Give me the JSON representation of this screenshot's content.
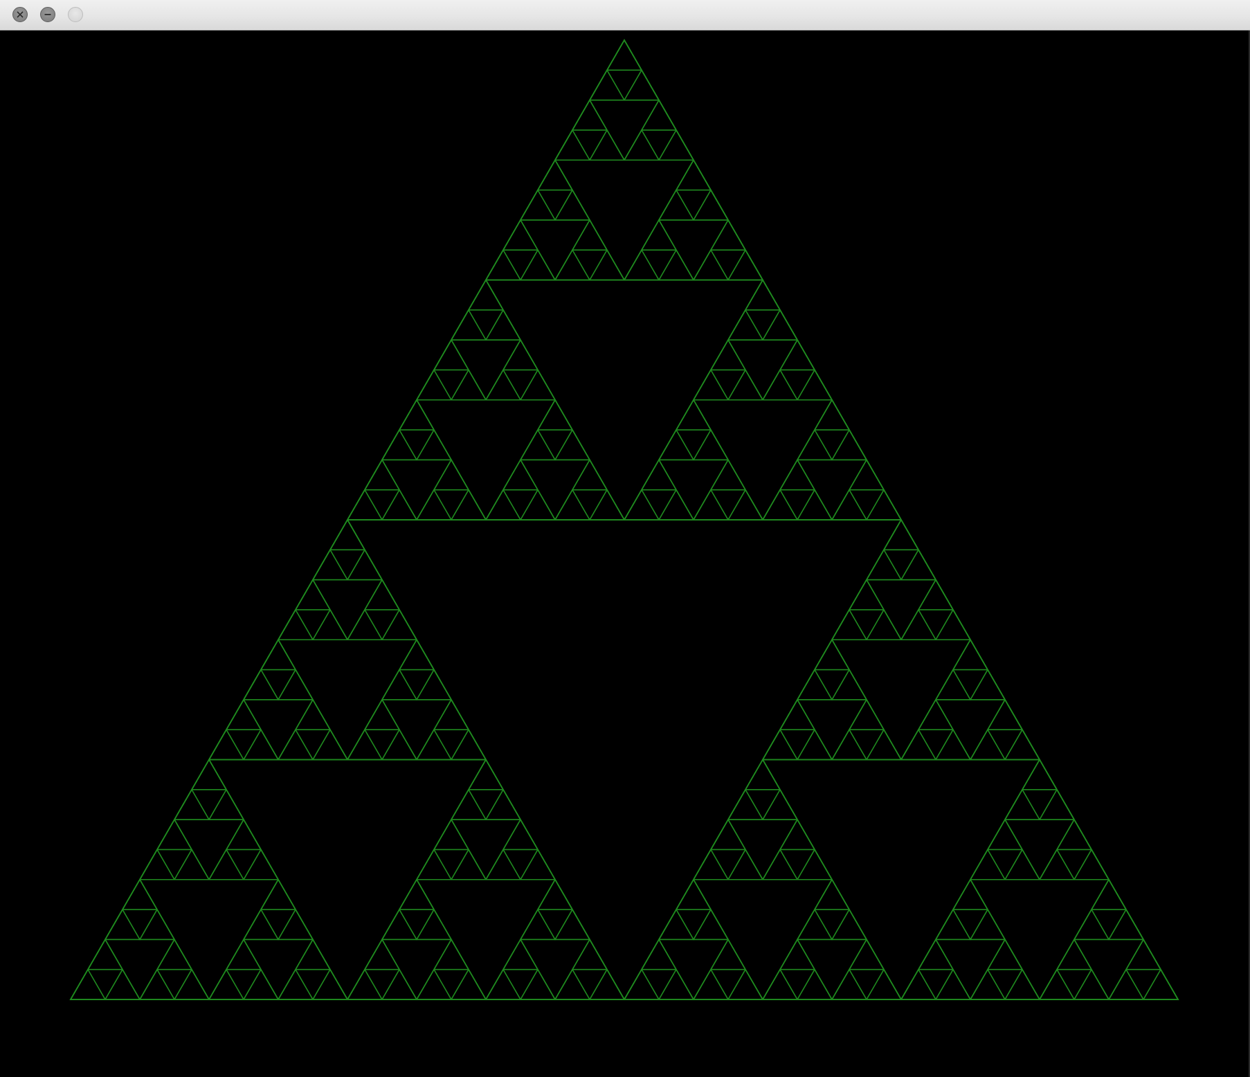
{
  "window": {
    "title": "",
    "controls": {
      "close": "close-icon",
      "minimize": "minimize-icon",
      "zoom": "zoom-icon"
    }
  },
  "fractal": {
    "kind": "sierpinski-triangle",
    "depth": 6,
    "stroke_color": "#1f8a1f",
    "background_color": "#000000"
  }
}
